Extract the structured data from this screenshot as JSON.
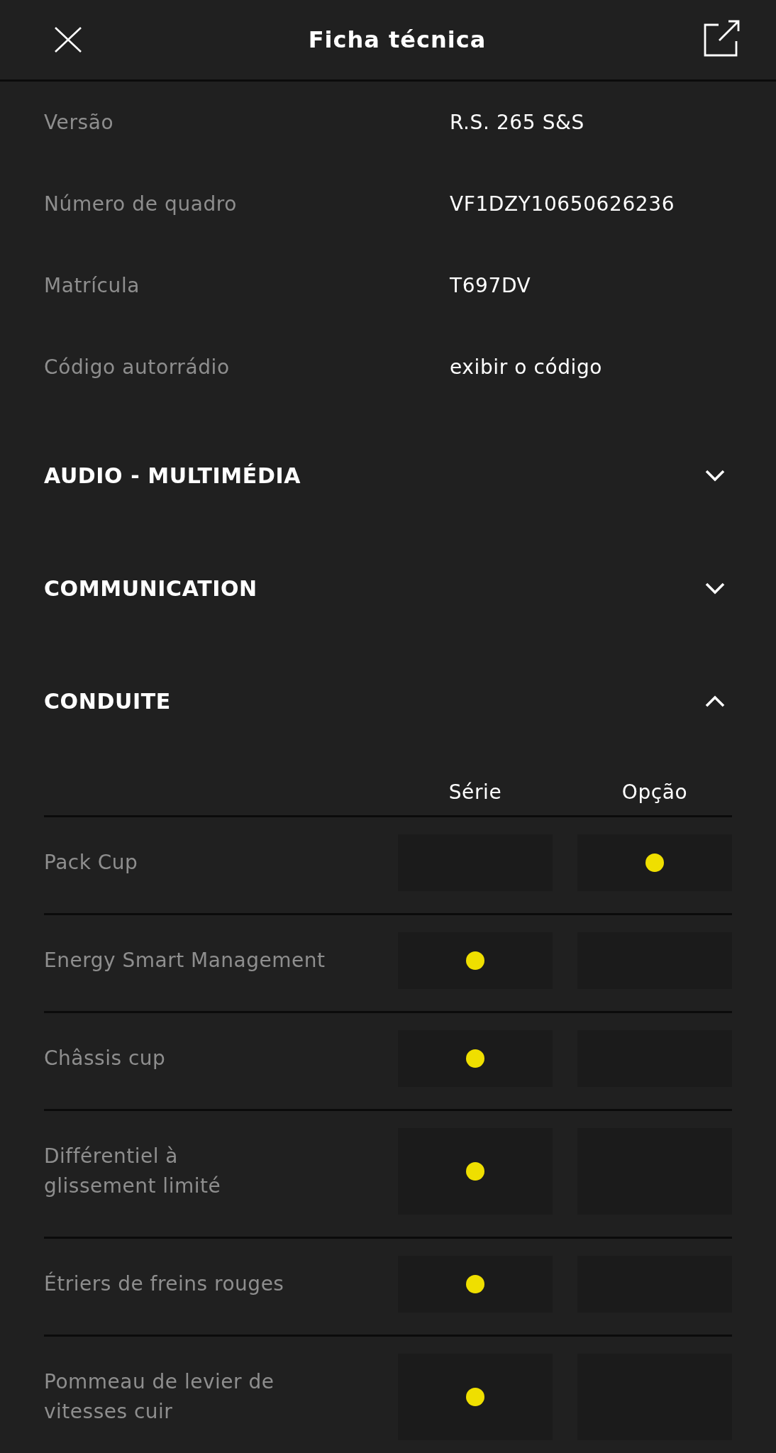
{
  "header": {
    "title": "Ficha técnica"
  },
  "specs": [
    {
      "label": "Versão",
      "value": "R.S. 265 S&S"
    },
    {
      "label": "Número de quadro",
      "value": "VF1DZY10650626236"
    },
    {
      "label": "Matrícula",
      "value": "T697DV"
    },
    {
      "label": "Código autorrádio",
      "value": "exibir o código"
    }
  ],
  "sections": [
    {
      "title": "AUDIO - MULTIMÉDIA",
      "expanded": false
    },
    {
      "title": "COMMUNICATION",
      "expanded": false
    },
    {
      "title": "CONDUITE",
      "expanded": true,
      "table": {
        "columns": [
          "Série",
          "Opção"
        ],
        "rows": [
          {
            "label": "Pack Cup",
            "standard": false,
            "optional": true
          },
          {
            "label": "Energy Smart Management",
            "standard": true,
            "optional": false
          },
          {
            "label": "Châssis cup",
            "standard": true,
            "optional": false
          },
          {
            "label": "Différentiel à\nglissement limité",
            "standard": true,
            "optional": false
          },
          {
            "label": "Étriers de freins rouges",
            "standard": true,
            "optional": false
          },
          {
            "label": "Pommeau de levier de\nvitesses cuir",
            "standard": true,
            "optional": false
          }
        ]
      }
    }
  ]
}
